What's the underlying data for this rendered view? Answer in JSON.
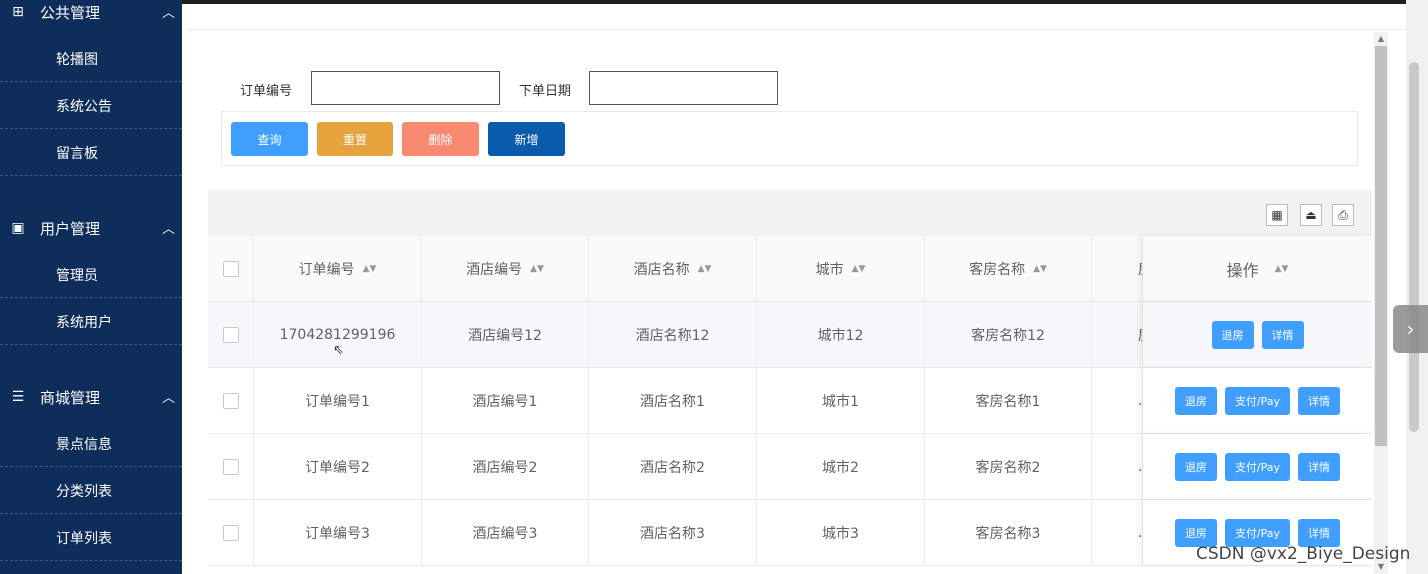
{
  "sidebar": {
    "groups": [
      {
        "label": "公共管理",
        "icon": "grid-icon",
        "items": [
          "轮播图",
          "系统公告",
          "留言板"
        ]
      },
      {
        "label": "用户管理",
        "icon": "book-icon",
        "items": [
          "管理员",
          "系统用户"
        ]
      },
      {
        "label": "商城管理",
        "icon": "list-icon",
        "items": [
          "景点信息",
          "分类列表",
          "订单列表"
        ]
      }
    ]
  },
  "search": {
    "order_no_label": "订单编号",
    "order_no_value": "",
    "date_label": "下单日期",
    "date_value": ""
  },
  "actions": {
    "query": "查询",
    "reset": "重置",
    "delete": "删除",
    "add": "新增"
  },
  "colors": {
    "sidebar_bg": "#0e2d5a",
    "query": "#409eff",
    "reset": "#e6a23c",
    "delete": "#f78a71",
    "add": "#0a5bab",
    "op_button": "#409eff"
  },
  "toolbar_icons": [
    "columns-icon",
    "export-icon",
    "print-icon"
  ],
  "table": {
    "columns": [
      "订单编号",
      "酒店编号",
      "酒店名称",
      "城市",
      "客房名称",
      "房"
    ],
    "op_header": "操作",
    "rows": [
      {
        "cells": [
          "1704281299196",
          "酒店编号12",
          "酒店名称12",
          "城市12",
          "客房名称12",
          "房"
        ],
        "ops": [
          "退房",
          "详情"
        ]
      },
      {
        "cells": [
          "订单编号1",
          "酒店编号1",
          "酒店名称1",
          "城市1",
          "客房名称1",
          "."
        ],
        "ops": [
          "退房",
          "支付/Pay",
          "详情"
        ]
      },
      {
        "cells": [
          "订单编号2",
          "酒店编号2",
          "酒店名称2",
          "城市2",
          "客房名称2",
          "."
        ],
        "ops": [
          "退房",
          "支付/Pay",
          "详情"
        ]
      },
      {
        "cells": [
          "订单编号3",
          "酒店编号3",
          "酒店名称3",
          "城市3",
          "客房名称3",
          "."
        ],
        "ops": [
          "退房",
          "支付/Pay",
          "详情"
        ]
      }
    ]
  },
  "watermark": "CSDN @vx2_Biye_Design"
}
